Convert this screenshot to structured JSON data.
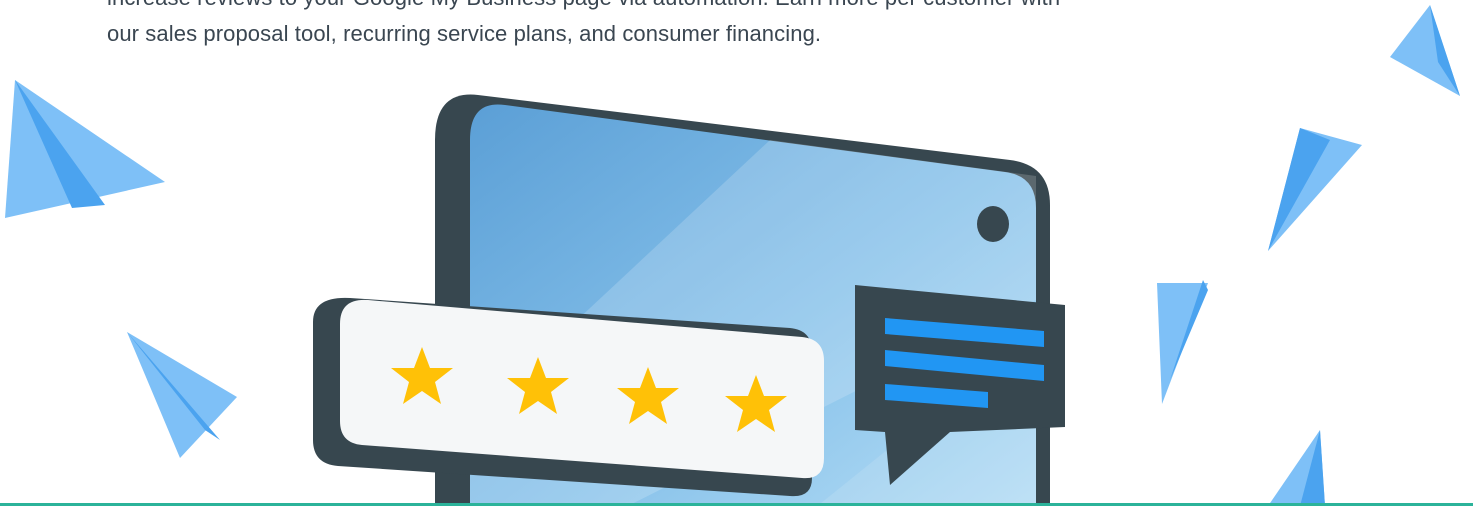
{
  "content": {
    "line_1": "increase reviews to your Google My Business page via automation. Earn more per customer with",
    "line_2": "our sales proposal tool, recurring service plans, and consumer financing."
  },
  "illustration": {
    "rating_stars": 4,
    "colors": {
      "phone_frame": "#37474f",
      "screen_blue": "#5fa8dc",
      "screen_light": "#9fd0ef",
      "star": "#ffc107",
      "chat_bubble": "#37474f",
      "chat_lines": "#2196f3",
      "paper_plane": "#64b5f6",
      "accent_rule": "#2bb39a"
    }
  }
}
